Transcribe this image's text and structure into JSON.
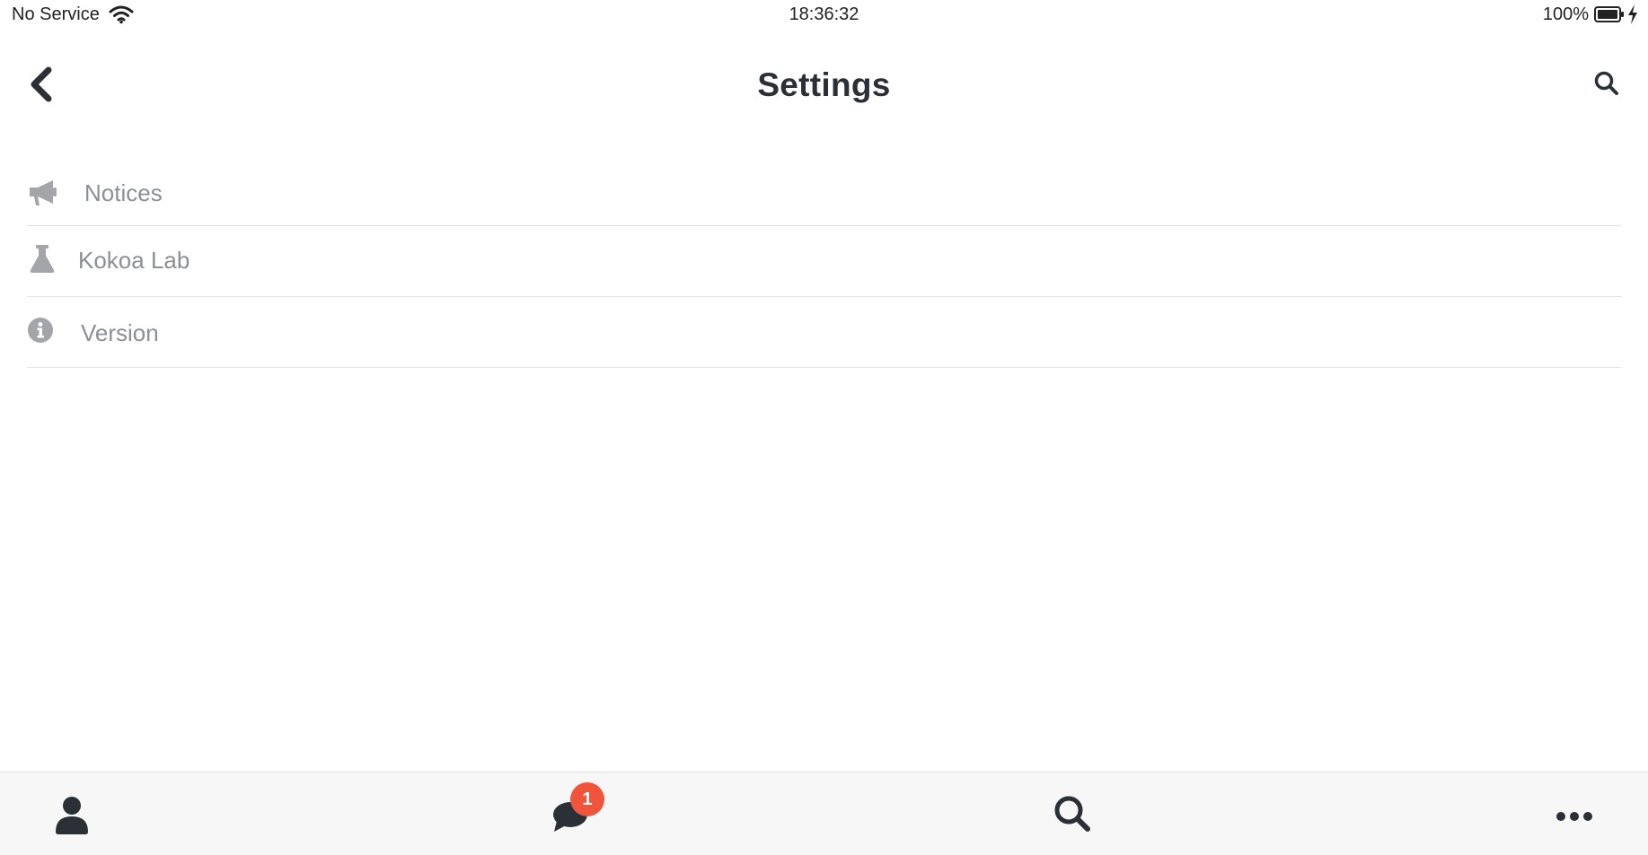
{
  "status_bar": {
    "carrier": "No Service",
    "time": "18:36:32",
    "battery_percent": "100%",
    "icons": [
      "wifi-icon",
      "battery-icon",
      "charging-bolt-icon"
    ]
  },
  "header": {
    "title": "Settings",
    "back_icon": "chevron-left-icon",
    "search_icon": "search-icon"
  },
  "settings": {
    "items": [
      {
        "label": "Notices",
        "icon": "megaphone-icon"
      },
      {
        "label": "Kokoa Lab",
        "icon": "flask-icon"
      },
      {
        "label": "Version",
        "icon": "info-circle-icon"
      }
    ]
  },
  "tab_bar": {
    "tabs": [
      {
        "name": "friends",
        "icon": "user-icon"
      },
      {
        "name": "chats",
        "icon": "chat-bubbles-icon",
        "badge": "1"
      },
      {
        "name": "search",
        "icon": "search-icon"
      },
      {
        "name": "more",
        "icon": "ellipsis-icon"
      }
    ],
    "badge_color": "#f0553c"
  },
  "colors": {
    "text_dark": "#2b2f36",
    "text_muted": "#8c8f94",
    "icon_muted": "#a3a5a9",
    "divider": "#e4e4e4",
    "tab_bar_bg": "#f7f7f7"
  }
}
